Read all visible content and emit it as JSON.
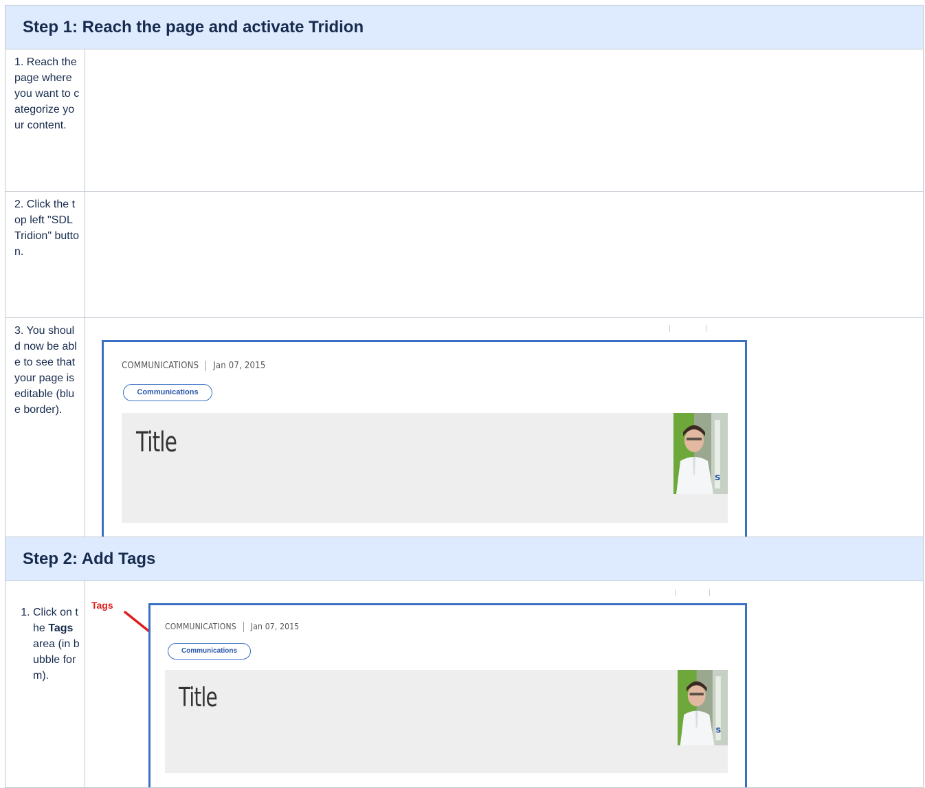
{
  "step1": {
    "title": "Step 1: Reach the page and activate Tridion",
    "rows": [
      {
        "text": "1. Reach the page where you want to categorize your content."
      },
      {
        "text": "2. Click the top left \"SDL Tridion\" button."
      },
      {
        "text": "3. You should now be able to see that your page is editable (blue border)."
      }
    ]
  },
  "step2": {
    "title": "Step 2: Add Tags",
    "item": {
      "before": "Click on the ",
      "bold": "Tags",
      "after": " area (in bubble form)."
    }
  },
  "screenshot": {
    "category": "COMMUNICATIONS",
    "date": "Jan 07, 2015",
    "tag": "Communications",
    "title": "Title",
    "annotation": "Tags",
    "colors": {
      "frame": "#3a6fc4",
      "annotation": "#e01b1b",
      "hero_bg": "#eeeeee"
    }
  }
}
